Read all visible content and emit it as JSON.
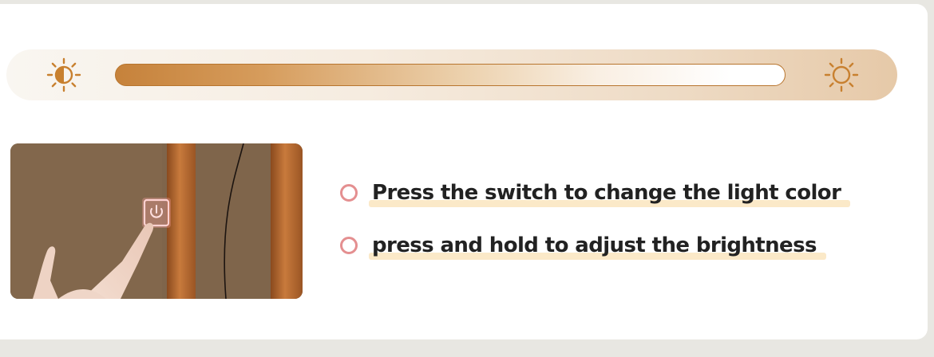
{
  "brightness": {
    "dim_icon": "sun-half-icon",
    "bright_icon": "sun-outline-icon",
    "colors": {
      "accent": "#c6823b",
      "track": "#eedbc5"
    }
  },
  "photo": {
    "switch_icon": "power-icon",
    "switch_glow": "#f06a6a"
  },
  "instructions": [
    {
      "text": "Press the switch to change the light color"
    },
    {
      "text": "press and hold to adjust the brightness"
    }
  ],
  "colors": {
    "bullet": "#e48f90",
    "highlight": "#fbe9c8",
    "text": "#222222"
  }
}
